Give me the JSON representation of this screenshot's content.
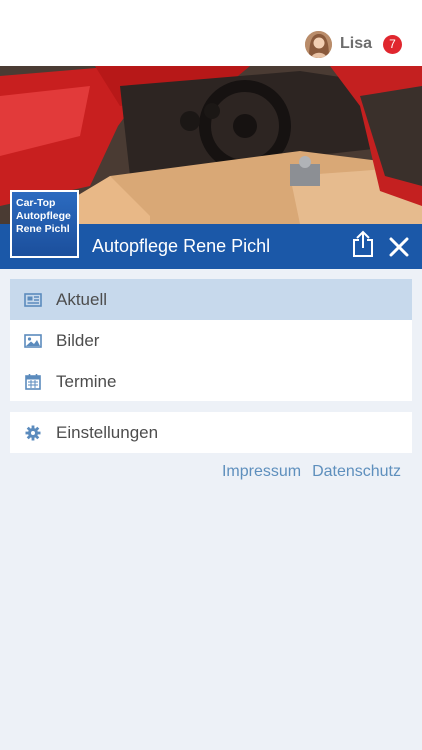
{
  "header": {
    "user_name": "Lisa",
    "notification_count": "7",
    "avatar_icon": "user-avatar"
  },
  "hero": {
    "image": "car-interior-photo",
    "logo_lines": [
      "Car-Top",
      "Autopflege",
      "Rene Pichl"
    ]
  },
  "titlebar": {
    "title": "Autopflege Rene Pichl",
    "share_icon": "share-icon",
    "close_icon": "close-icon"
  },
  "menu": {
    "items": [
      {
        "label": "Aktuell",
        "icon": "newspaper-icon",
        "active": true
      },
      {
        "label": "Bilder",
        "icon": "image-icon",
        "active": false
      },
      {
        "label": "Termine",
        "icon": "calendar-icon",
        "active": false
      }
    ],
    "settings": {
      "label": "Einstellungen",
      "icon": "gear-icon"
    }
  },
  "footer": {
    "impressum": "Impressum",
    "datenschutz": "Datenschutz"
  },
  "colors": {
    "primary_blue": "#1b58a8",
    "active_row": "#c7d9ec",
    "background": "#edf1f7",
    "badge": "#e0262e",
    "link": "#5e8fbd"
  }
}
